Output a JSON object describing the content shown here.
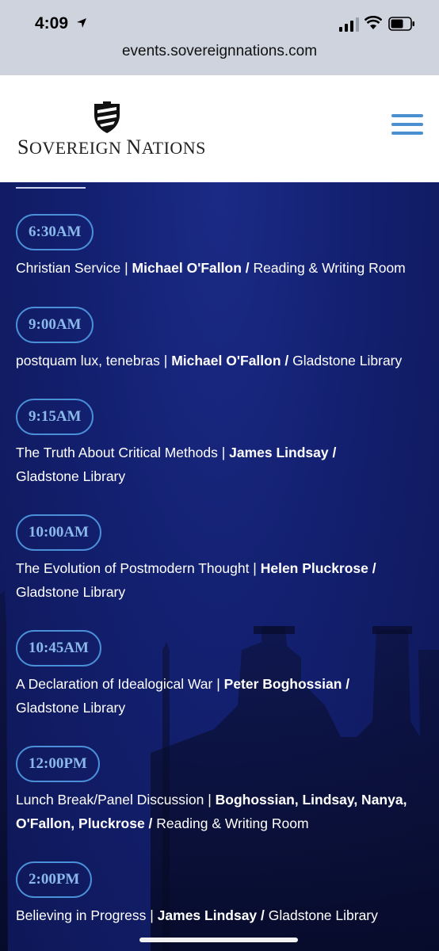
{
  "status_bar": {
    "time": "4:09",
    "url": "events.sovereignnations.com"
  },
  "brand": {
    "name_part1": "S",
    "name_part2": "OVEREIGN ",
    "name_part3": "N",
    "name_part4": "ATIONS"
  },
  "events": [
    {
      "time": "6:30AM",
      "title": "Christian Service | ",
      "speaker": "Michael O'Fallon /",
      "location": " Reading & Writing Room"
    },
    {
      "time": "9:00AM",
      "title": "postquam lux, tenebras | ",
      "speaker": "Michael O'Fallon /",
      "location": " Gladstone Library"
    },
    {
      "time": "9:15AM",
      "title": "The Truth About Critical Methods | ",
      "speaker": "James Lindsay /",
      "location": " Gladstone Library"
    },
    {
      "time": "10:00AM",
      "title": "The Evolution of Postmodern Thought | ",
      "speaker": "Helen Pluckrose /",
      "location": " Gladstone Library"
    },
    {
      "time": "10:45AM",
      "title": "A Declaration of Idealogical War | ",
      "speaker": "Peter Boghossian /",
      "location": " Gladstone Library"
    },
    {
      "time": "12:00PM",
      "title": "Lunch Break/Panel Discussion | ",
      "speaker": "Boghossian, Lindsay, Nanya, O'Fallon, Pluckrose /",
      "location": " Reading & Writing Room"
    },
    {
      "time": "2:00PM",
      "title": "Believing in Progress | ",
      "speaker": "James Lindsay /",
      "location": " Gladstone Library"
    }
  ]
}
